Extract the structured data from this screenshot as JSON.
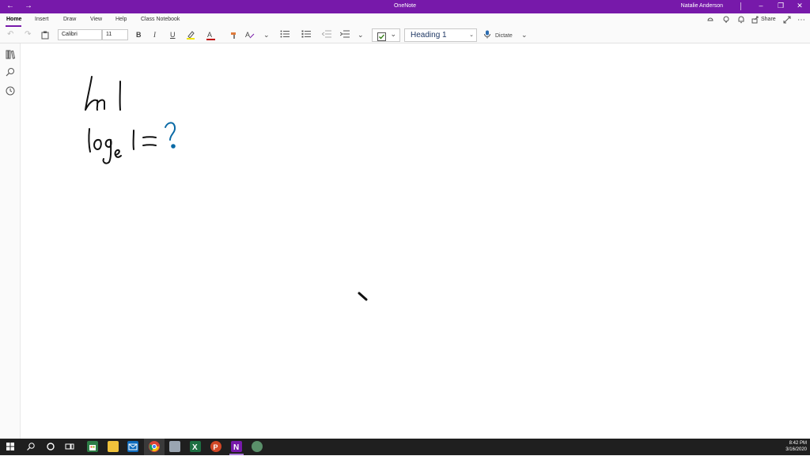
{
  "titlebar": {
    "app_title": "OneNote",
    "user_name": "Natalie Anderson",
    "back_glyph": "←",
    "forward_glyph": "→",
    "minimize_glyph": "–",
    "restore_glyph": "❐",
    "close_glyph": "✕",
    "accent_color": "#7719aa"
  },
  "menubar": {
    "tabs": [
      {
        "label": "Home",
        "active": true
      },
      {
        "label": "Insert"
      },
      {
        "label": "Draw"
      },
      {
        "label": "View"
      },
      {
        "label": "Help"
      },
      {
        "label": "Class Notebook"
      }
    ],
    "share_label": "Share",
    "more_glyph": "⋯"
  },
  "toolbar": {
    "undo_glyph": "↶",
    "redo_glyph": "↷",
    "font_name": "Calibri",
    "font_size": "11",
    "bold_label": "B",
    "italic_label": "I",
    "underline_label": "U",
    "font_color_label": "A",
    "style_name": "Heading 1",
    "dictate_label": "Dictate",
    "dropdown_glyph": "⌄",
    "bullets_icon": "bullet-list-icon",
    "numbering_icon": "numbered-list-icon"
  },
  "sidebar": {
    "icons": [
      "notebooks-icon",
      "search-icon",
      "recent-icon"
    ]
  },
  "taskbar": {
    "apps": [
      "start",
      "search",
      "task-view",
      "multitask",
      "store",
      "file-explorer",
      "mail",
      "chrome",
      "app",
      "excel",
      "powerpoint",
      "onenote",
      "browser"
    ],
    "time": "8:42 PM",
    "date": "3/16/2020"
  }
}
